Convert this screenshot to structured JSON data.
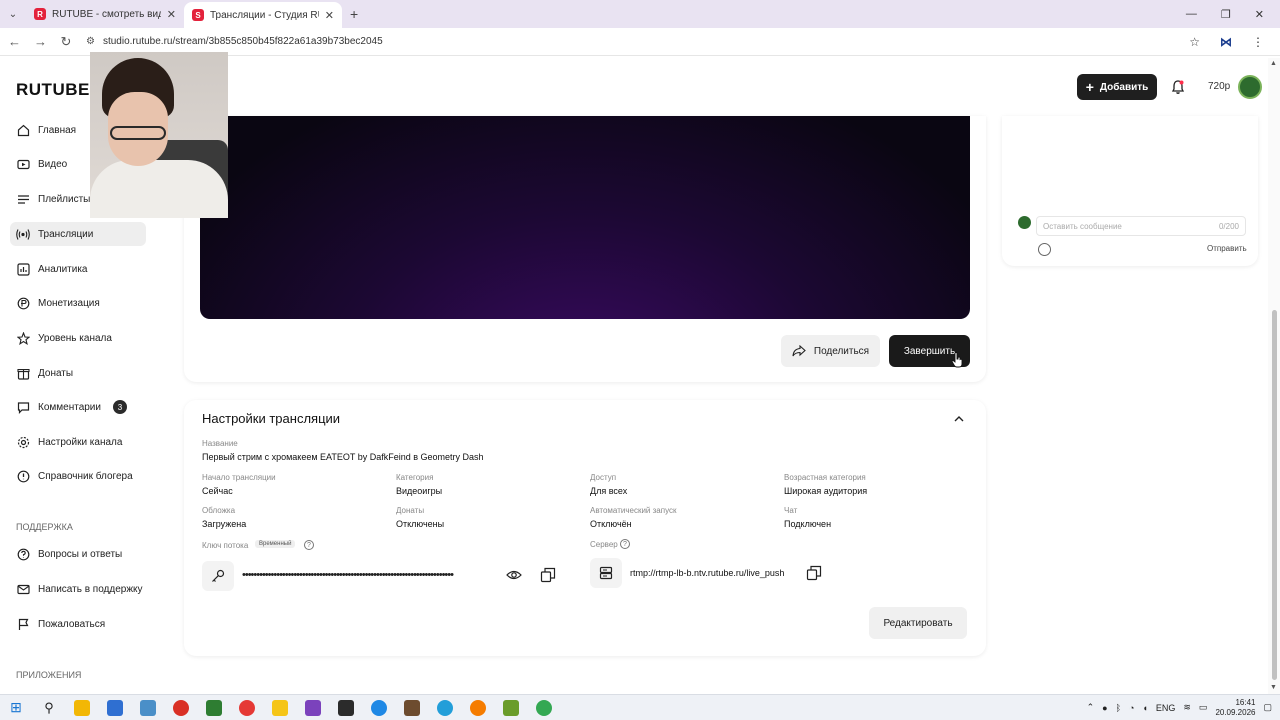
{
  "browser": {
    "tabs": [
      {
        "title": "RUTUBE - смотреть видео он...",
        "favicon": "R",
        "favicon_color": "#e3223c"
      },
      {
        "title": "Трансляции - Студия RUTUBE",
        "favicon": "S",
        "favicon_color": "#e3223c"
      }
    ],
    "url": "studio.rutube.ru/stream/3b855c850b45f822a61a39b73bec2045"
  },
  "header": {
    "logo": "RUTUBE",
    "add_label": "Добавить",
    "quality": "720p"
  },
  "sidebar": {
    "items": [
      {
        "label": "Главная",
        "icon": "home-icon"
      },
      {
        "label": "Видео",
        "icon": "video-icon"
      },
      {
        "label": "Плейлисты",
        "icon": "playlist-icon"
      },
      {
        "label": "Трансляции",
        "icon": "broadcast-icon",
        "active": true
      },
      {
        "label": "Аналитика",
        "icon": "analytics-icon"
      },
      {
        "label": "Монетизация",
        "icon": "monetization-icon"
      },
      {
        "label": "Уровень канала",
        "icon": "star-icon"
      },
      {
        "label": "Донаты",
        "icon": "donate-icon"
      },
      {
        "label": "Комментарии",
        "icon": "comment-icon",
        "badge": "3"
      },
      {
        "label": "Настройки канала",
        "icon": "gear-icon"
      },
      {
        "label": "Справочник блогера",
        "icon": "book-icon"
      }
    ],
    "support_heading": "ПОДДЕРЖКА",
    "support_items": [
      {
        "label": "Вопросы и ответы",
        "icon": "question-icon"
      },
      {
        "label": "Написать в поддержку",
        "icon": "mail-icon"
      },
      {
        "label": "Пожаловаться",
        "icon": "flag-icon"
      }
    ],
    "apps_heading": "ПРИЛОЖЕНИЯ"
  },
  "player": {
    "share_label": "Поделиться",
    "finish_label": "Завершить"
  },
  "chat": {
    "placeholder": "Оставить сообщение",
    "counter": "0/200",
    "send_label": "Отправить"
  },
  "settings": {
    "title": "Настройки трансляции",
    "name_label": "Название",
    "name_value": "Первый стрим с хромакеем EATEOT by DafkFeind в Geometry Dash",
    "start_label": "Начало трансляции",
    "start_value": "Сейчас",
    "category_label": "Категория",
    "category_value": "Видеоигры",
    "access_label": "Доступ",
    "access_value": "Для всех",
    "age_label": "Возрастная категория",
    "age_value": "Широкая аудитория",
    "cover_label": "Обложка",
    "cover_value": "Загружена",
    "donations_label": "Донаты",
    "donations_value": "Отключены",
    "autostart_label": "Автоматический запуск",
    "autostart_value": "Отключён",
    "chat_label": "Чат",
    "chat_value": "Подключен",
    "key_label": "Ключ потока",
    "key_badge": "Временный",
    "key_masked": "••••••••••••••••••••••••••••••••••••••••••••••••••••••••••••••••••••••••••",
    "server_label": "Сервер",
    "server_value": "rtmp://rtmp-lb-b.ntv.rutube.ru/live_push",
    "edit_label": "Редактировать"
  },
  "taskbar": {
    "lang": "ENG",
    "time": "16:41",
    "date": "20.09.2026"
  }
}
